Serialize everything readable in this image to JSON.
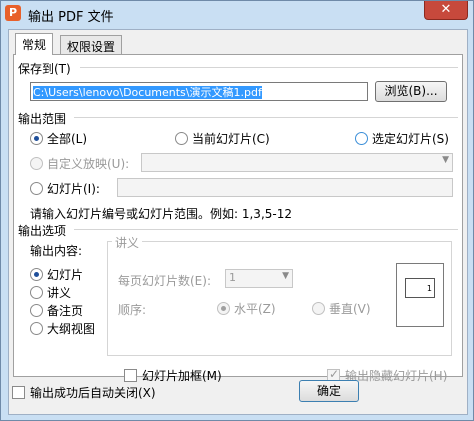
{
  "window": {
    "app_icon_glyph": "P",
    "title": "输出 PDF 文件",
    "close_glyph": "✕"
  },
  "tabs": [
    {
      "label": "常规"
    },
    {
      "label": "权限设置"
    }
  ],
  "save_to": {
    "label": "保存到(T)",
    "path": "C:\\Users\\lenovo\\Documents\\演示文稿1.pdf",
    "browse_label": "浏览(B)..."
  },
  "range": {
    "label": "输出范围",
    "all": "全部(L)",
    "current": "当前幻灯片(C)",
    "selected": "选定幻灯片(S)",
    "custom_show": "自定义放映(U):",
    "slides": "幻灯片(I):",
    "hint": "请输入幻灯片编号或幻灯片范围。例如: 1,3,5-12"
  },
  "options": {
    "label": "输出选项",
    "content_label": "输出内容:",
    "content_items": [
      "幻灯片",
      "讲义",
      "备注页",
      "大纲视图"
    ],
    "handout_title": "讲义",
    "per_page_label": "每页幻灯片数(E):",
    "per_page_value": "1",
    "order_label": "顺序:",
    "horizontal": "水平(Z)",
    "vertical": "垂直(V)",
    "preview_num": "1",
    "frame_slides": "幻灯片加框(M)",
    "hidden_slides": "输出隐藏幻灯片(H)"
  },
  "footer": {
    "auto_close": "输出成功后自动关闭(X)",
    "ok": "确定"
  },
  "icons": {
    "arrow": "▼"
  }
}
